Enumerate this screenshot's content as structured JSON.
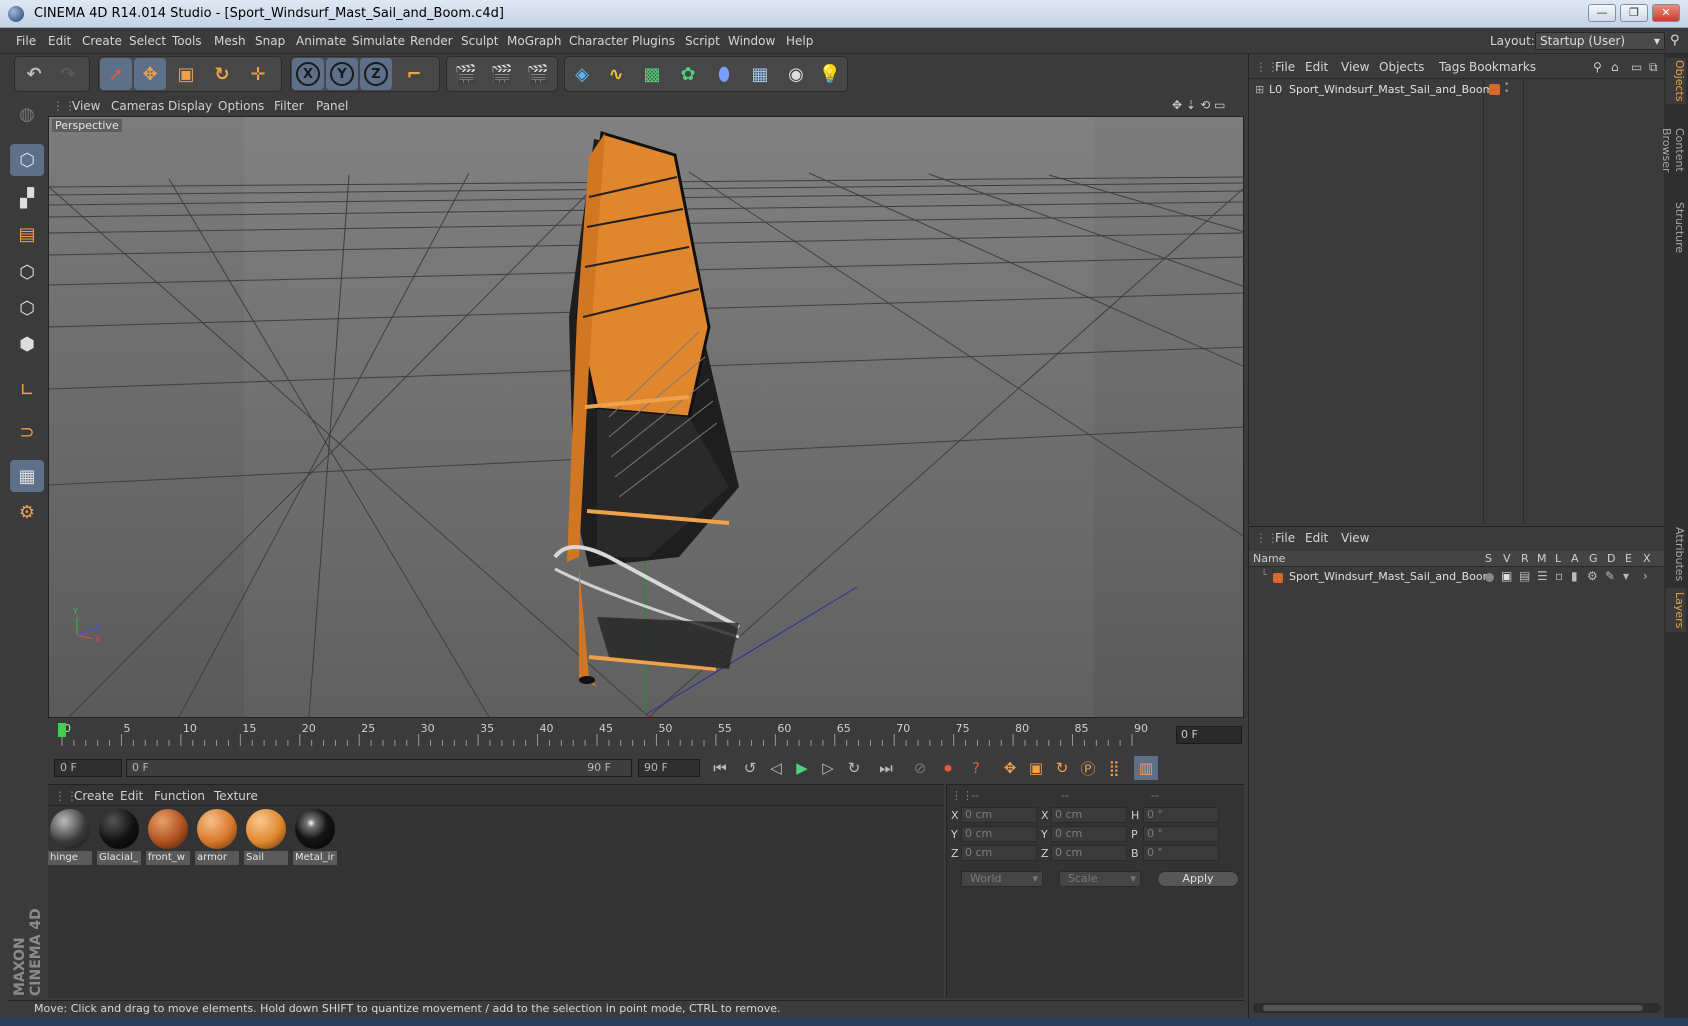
{
  "window": {
    "title": "CINEMA 4D R14.014 Studio - [Sport_Windsurf_Mast_Sail_and_Boom.c4d]",
    "controls": [
      "—",
      "❐",
      "✕"
    ]
  },
  "menubar": {
    "items": [
      "File",
      "Edit",
      "Create",
      "Select",
      "Tools",
      "Mesh",
      "Snap",
      "Animate",
      "Simulate",
      "Render",
      "Sculpt",
      "MoGraph",
      "Character",
      "Plugins",
      "Script",
      "Window",
      "Help"
    ],
    "layout_label": "Layout:",
    "layout_value": "Startup (User)"
  },
  "toolbar": {
    "axis_x": "X",
    "axis_y": "Y",
    "axis_z": "Z"
  },
  "viewport": {
    "menu": [
      "View",
      "Cameras",
      "Display",
      "Options",
      "Filter",
      "Panel"
    ],
    "camera_label": "Perspective",
    "axis_y": "Y",
    "axis_z": "Z",
    "axis_x": "X"
  },
  "timeline": {
    "ticks": [
      "0",
      "5",
      "10",
      "15",
      "20",
      "25",
      "30",
      "35",
      "40",
      "45",
      "50",
      "55",
      "60",
      "65",
      "70",
      "75",
      "80",
      "85",
      "90"
    ],
    "current_frame": "0 F",
    "current_frame_marker": 0
  },
  "playback": {
    "start_field": "0 F",
    "range_start": "0 F",
    "range_end": "90 F",
    "end_field": "90 F"
  },
  "materials": {
    "menu": [
      "Create",
      "Edit",
      "Function",
      "Texture"
    ],
    "items": [
      {
        "label": "hinge",
        "color": "#3a3a3a"
      },
      {
        "label": "Glacial_",
        "color": "#101010"
      },
      {
        "label": "front_w",
        "color": "#b0521f"
      },
      {
        "label": "armor",
        "color": "#d9782a"
      },
      {
        "label": "Sail",
        "color": "#e0892d"
      },
      {
        "label": "Metal_ir",
        "color": "#151515"
      }
    ]
  },
  "coordinates": {
    "headers": [
      "--",
      "--",
      "--"
    ],
    "rows": [
      {
        "l1": "X",
        "v1": "0 cm",
        "l2": "X",
        "v2": "0 cm",
        "l3": "H",
        "v3": "0 °"
      },
      {
        "l1": "Y",
        "v1": "0 cm",
        "l2": "Y",
        "v2": "0 cm",
        "l3": "P",
        "v3": "0 °"
      },
      {
        "l1": "Z",
        "v1": "0 cm",
        "l2": "Z",
        "v2": "0 cm",
        "l3": "B",
        "v3": "0 °"
      }
    ],
    "mode1": "World",
    "mode2": "Scale",
    "apply": "Apply"
  },
  "status": {
    "text": "Move: Click and drag to move elements. Hold down SHIFT to quantize movement / add to the selection in point mode, CTRL to remove."
  },
  "objects_panel": {
    "menu": [
      "File",
      "Edit",
      "View",
      "Objects",
      "Tags",
      "Bookmarks"
    ],
    "object_name": "Sport_Windsurf_Mast_Sail_and_Boom",
    "object_prefix": "L0"
  },
  "layers_panel": {
    "menu": [
      "File",
      "Edit",
      "View"
    ],
    "columns": [
      "Name",
      "S",
      "V",
      "R",
      "M",
      "L",
      "A",
      "G",
      "D",
      "E",
      "X"
    ],
    "layer_name": "Sport_Windsurf_Mast_Sail_and_Boom"
  },
  "side_tabs": [
    "Objects",
    "Content Browser",
    "Structure",
    "Attributes",
    "Layers"
  ],
  "logo": {
    "line1": "MAXON",
    "line2": "CINEMA 4D"
  },
  "colors": {
    "accent": "#f0a24b",
    "sail": "#e0862c",
    "background": "#3b3b3b"
  }
}
